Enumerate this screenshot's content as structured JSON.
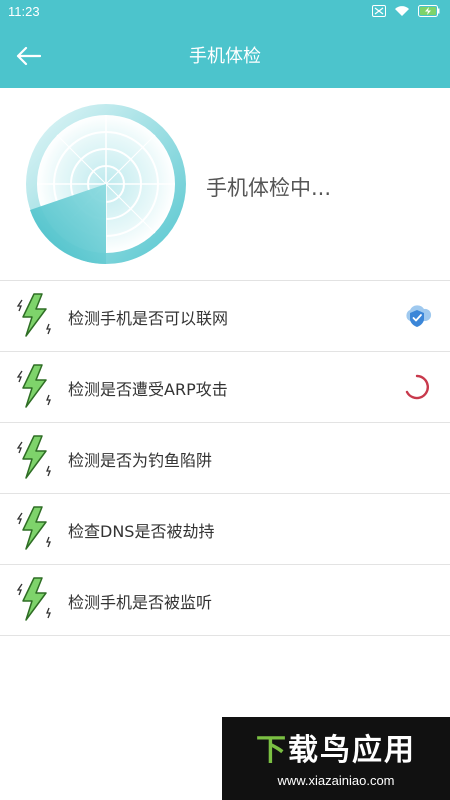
{
  "status_bar": {
    "time": "11:23"
  },
  "app_bar": {
    "title": "手机体检"
  },
  "scan": {
    "status_text": "手机体检中..."
  },
  "checks": [
    {
      "label": "检测手机是否可以联网",
      "state": "done",
      "state_icon": "shield-check-icon"
    },
    {
      "label": "检测是否遭受ARP攻击",
      "state": "running",
      "state_icon": "loading-spinner-icon"
    },
    {
      "label": "检测是否为钓鱼陷阱",
      "state": "pending"
    },
    {
      "label": "检查DNS是否被劫持",
      "state": "pending"
    },
    {
      "label": "检测手机是否被监听",
      "state": "pending"
    }
  ],
  "watermark": {
    "title_first": "下",
    "title_rest": "载鸟应用",
    "url": "www.xiazainiao.com"
  },
  "colors": {
    "primary": "#4cc4cc",
    "bolt_green": "#7ed36b",
    "shield_blue": "#3b86d8",
    "spinner_red": "#c8394c"
  }
}
